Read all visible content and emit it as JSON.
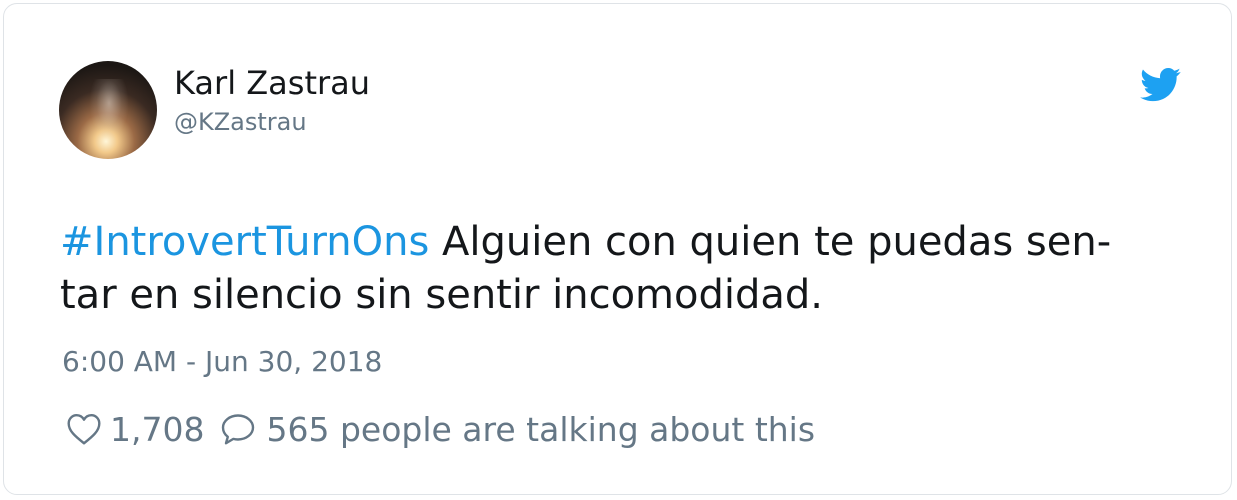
{
  "tweet": {
    "author": {
      "display_name": "Karl Zastrau",
      "handle": "@KZastrau"
    },
    "hashtag": "#IntrovertTurnOns",
    "text_line1": "Alguien con quien te puedas sen-",
    "text_line2": "tar en silencio sin sentir incomodidad.",
    "timestamp": "6:00 AM - Jun 30, 2018",
    "likes": "1,708",
    "talking": "565 people are talking about this"
  },
  "icons": {
    "brand": "twitter-bird-icon",
    "like": "heart-icon",
    "reply": "speech-bubble-icon"
  },
  "colors": {
    "brand": "#1da1f2",
    "hashtag": "#1b95e0",
    "text": "#14171a",
    "muted": "#657786"
  }
}
